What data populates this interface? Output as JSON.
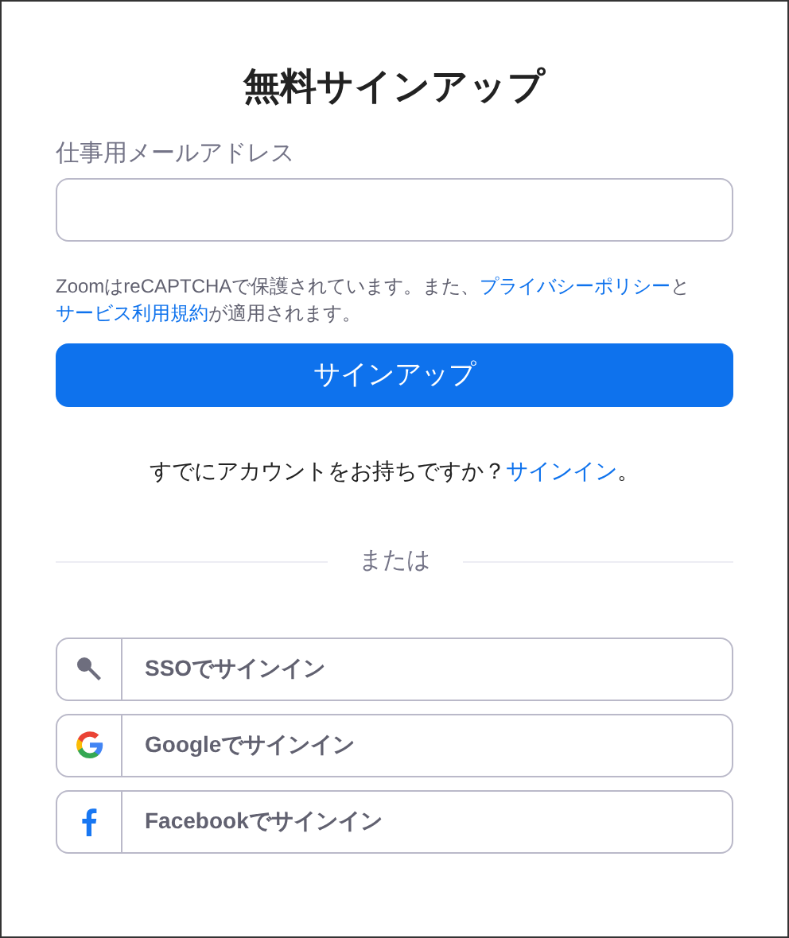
{
  "title": "無料サインアップ",
  "email_field": {
    "label": "仕事用メールアドレス"
  },
  "notice": [
    {
      "kind": "text",
      "text": "ZoomはreCAPTCHAで保護されています。また、"
    },
    {
      "kind": "link",
      "text": "プライバシーポリシー"
    },
    {
      "kind": "text",
      "text": "と"
    },
    {
      "kind": "link",
      "text": "サービス利用規約"
    },
    {
      "kind": "text",
      "text": "が適用されます。"
    }
  ],
  "signup_button": "サインアップ",
  "signin_prompt": [
    {
      "kind": "text",
      "text": "すでにアカウントをお持ちですか？"
    },
    {
      "kind": "link",
      "text": "サインイン"
    },
    {
      "kind": "text",
      "text": "。"
    }
  ],
  "divider": "または",
  "providers": [
    {
      "kind": "sso",
      "label": "SSOでサインイン"
    },
    {
      "kind": "google",
      "label": "Googleでサインイン"
    },
    {
      "kind": "facebook",
      "label": "Facebookでサインイン"
    }
  ]
}
